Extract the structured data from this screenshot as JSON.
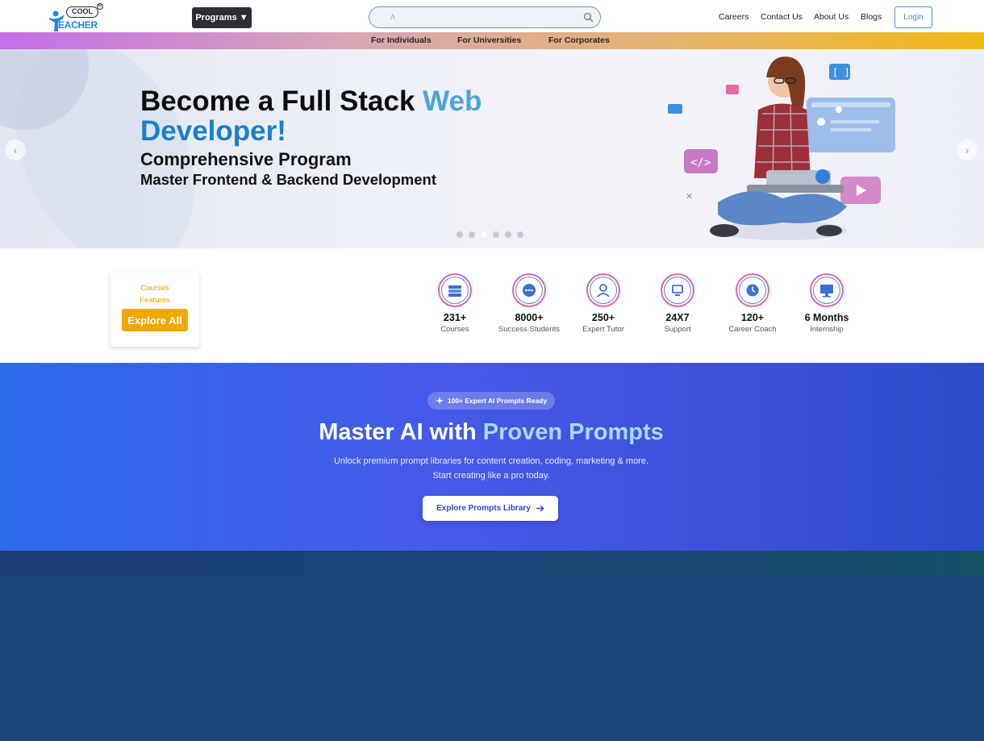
{
  "header": {
    "logo_top": "COOL",
    "logo_bottom": "EACHER",
    "programs_label": "Programs ▼",
    "search_placeholder": "A",
    "nav": [
      "Careers",
      "Contact Us",
      "About Us",
      "Blogs"
    ],
    "login_label": "Login"
  },
  "subnav": [
    "For Individuals",
    "For Universities",
    "For Corporates"
  ],
  "hero": {
    "title_part1": "Become a Full Stack ",
    "title_highlight": "Web",
    "title_part2": "Developer!",
    "subtitle": "Comprehensive Program",
    "tagline": "Master Frontend & Backend Development",
    "slides": 6,
    "active_slide": 3
  },
  "features_card": {
    "line1": "Courses",
    "line2": "Features",
    "button": "Explore All"
  },
  "stats": [
    {
      "value": "231+",
      "label": "Courses",
      "icon": "books-icon"
    },
    {
      "value": "8000+",
      "label": "Success Students",
      "icon": "chat-students-icon"
    },
    {
      "value": "250+",
      "label": "Expert Tutor",
      "icon": "tutor-icon"
    },
    {
      "value": "24X7",
      "label": "Support",
      "icon": "support-icon"
    },
    {
      "value": "120+",
      "label": "Career Coach",
      "icon": "coach-clock-icon"
    },
    {
      "value": "6 Months",
      "label": "Internship",
      "icon": "monitor-icon"
    }
  ],
  "ai_banner": {
    "badge": "100+ Expert AI Prompts Ready",
    "title_part1": "Master AI with ",
    "title_highlight": "Proven Prompts",
    "desc_line1": "Unlock premium prompt libraries for content creation, coding, marketing & more.",
    "desc_line2": "Start creating like a pro today.",
    "button": "Explore Prompts Library"
  },
  "colors": {
    "accent_blue": "#4aa3df",
    "cta_orange": "#f0a800",
    "banner_blue": "#4659e8",
    "footer_navy": "#1a4377"
  }
}
